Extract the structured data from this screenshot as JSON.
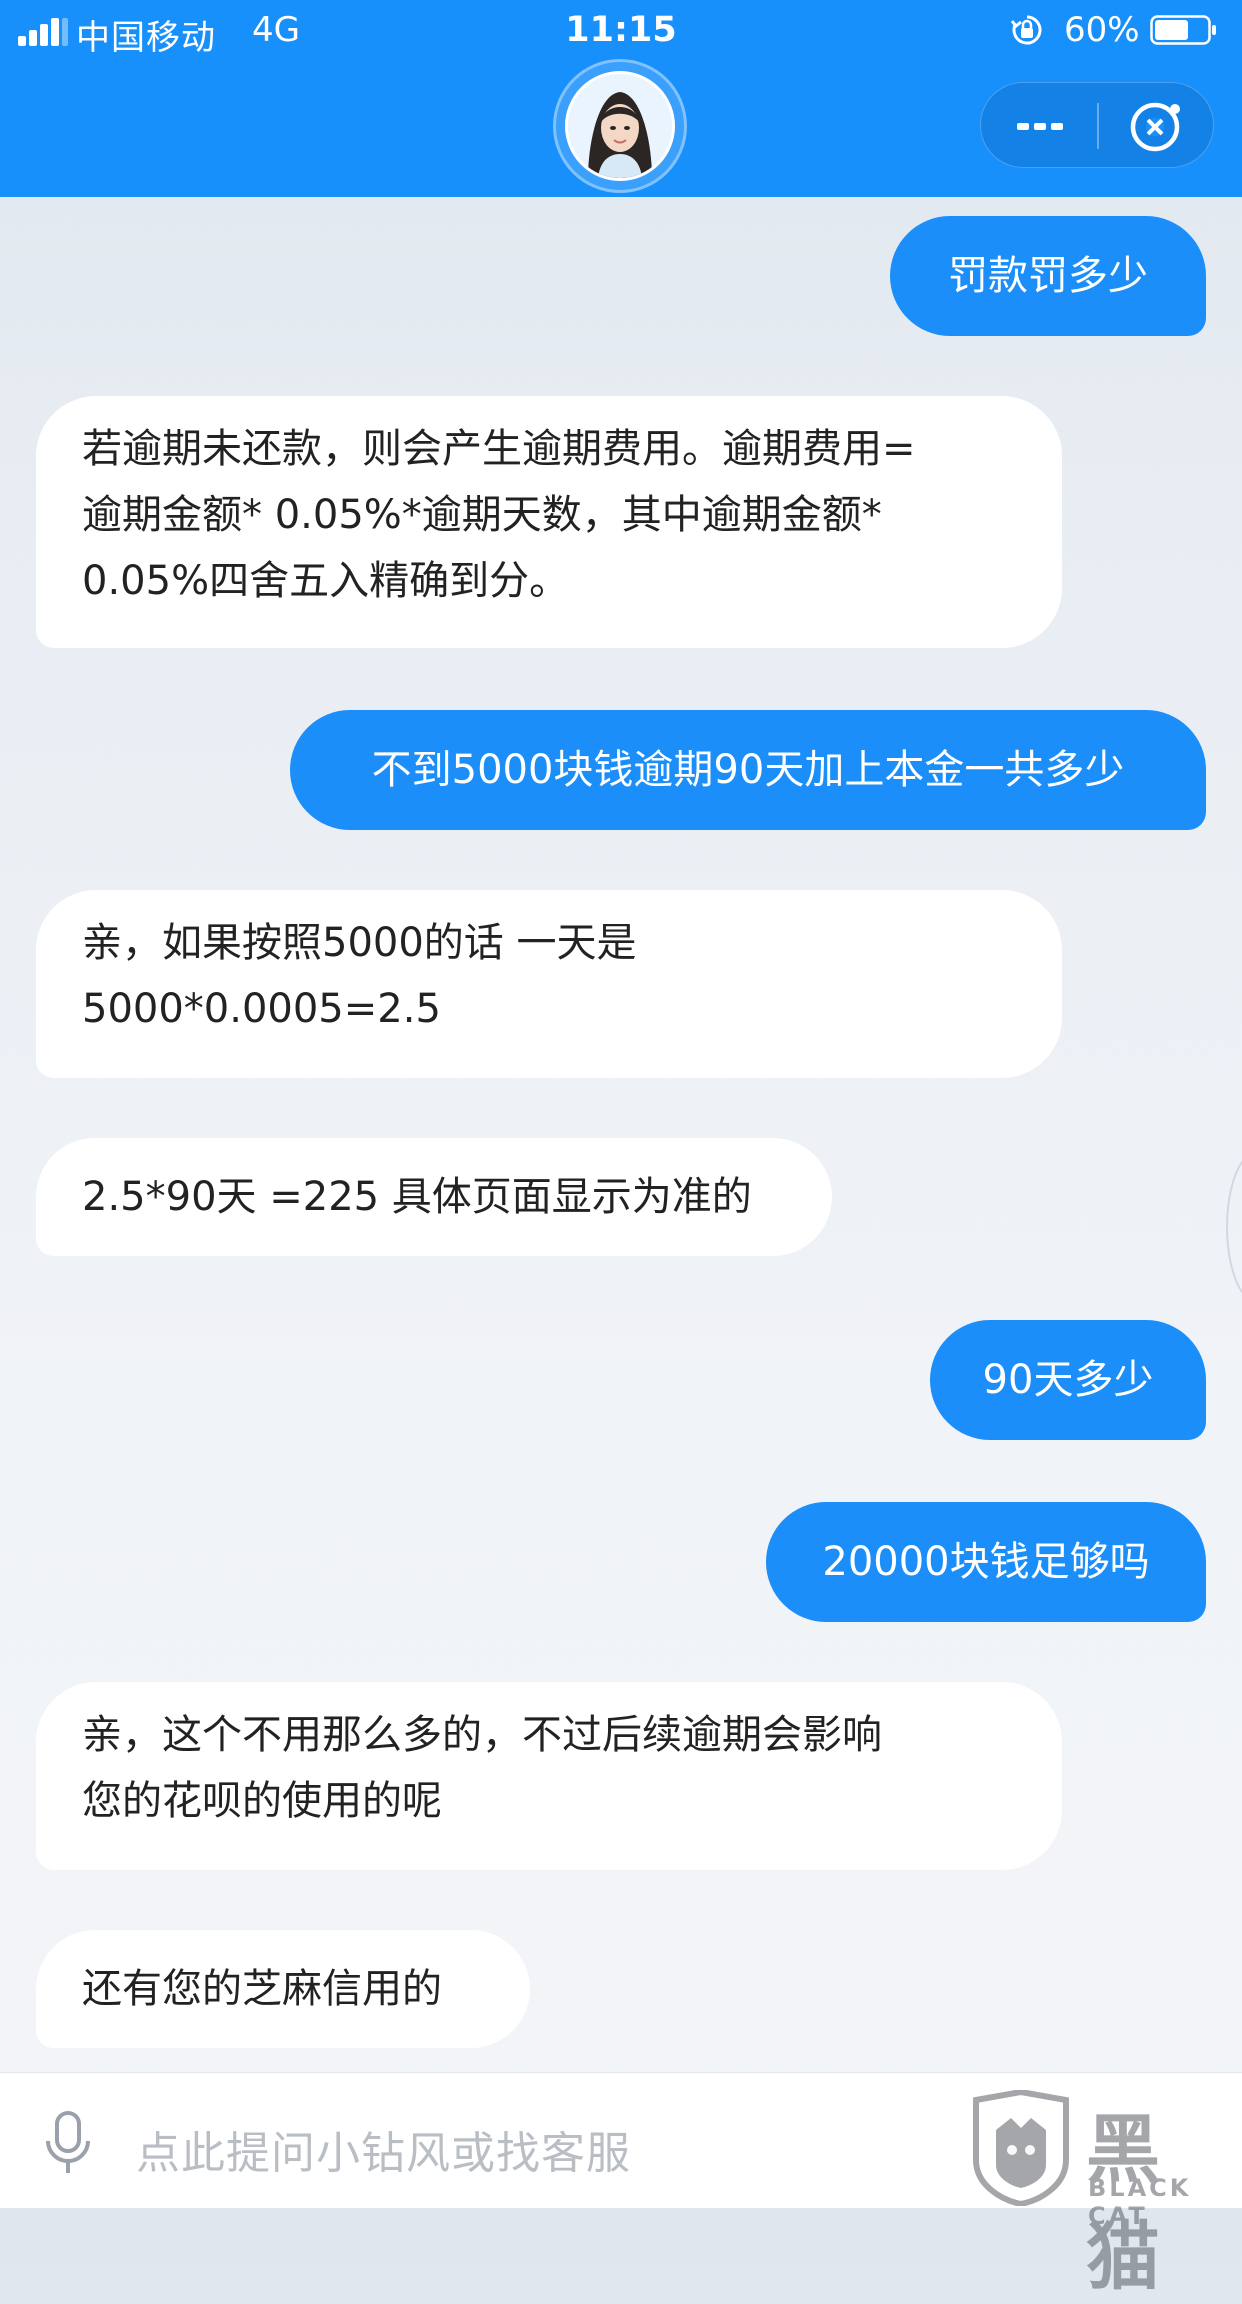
{
  "status_bar": {
    "carrier": "中国移动",
    "network": "4G",
    "time": "11:15",
    "battery": "60%"
  },
  "header": {
    "avatar_icon": "agent-avatar-icon",
    "more_icon": "more-dots-icon",
    "close_icon": "close-mini-program-icon"
  },
  "chat": {
    "messages": [
      {
        "role": "user",
        "text": "罚款罚多少"
      },
      {
        "role": "bot",
        "text": "若逾期未还款，则会产生逾期费用。逾期费用=\n逾期金额* 0.05%*逾期天数，其中逾期金额*\n0.05%四舍五入精确到分。"
      },
      {
        "role": "user",
        "text": "不到5000块钱逾期90天加上本金一共多少"
      },
      {
        "role": "bot",
        "text": "亲，如果按照5000的话 一天是\n5000*0.0005=2.5"
      },
      {
        "role": "bot",
        "text": "2.5*90天 =225 具体页面显示为准的"
      },
      {
        "role": "user",
        "text": "90天多少"
      },
      {
        "role": "user",
        "text": "20000块钱足够吗"
      },
      {
        "role": "bot",
        "text": "亲，这个不用那么多的，不过后续逾期会影响\n您的花呗的使用的呢"
      },
      {
        "role": "bot",
        "text": "还有您的芝麻信用的"
      }
    ]
  },
  "input": {
    "placeholder": "点此提问小钻风或找客服",
    "mic_icon": "microphone-icon"
  },
  "watermark": {
    "text": "黑猫",
    "subtext": "BLACK CAT"
  },
  "colors": {
    "header_bg": "#1890fb",
    "user_bubble": "#1b8ef9",
    "bot_bubble": "#ffffff"
  }
}
